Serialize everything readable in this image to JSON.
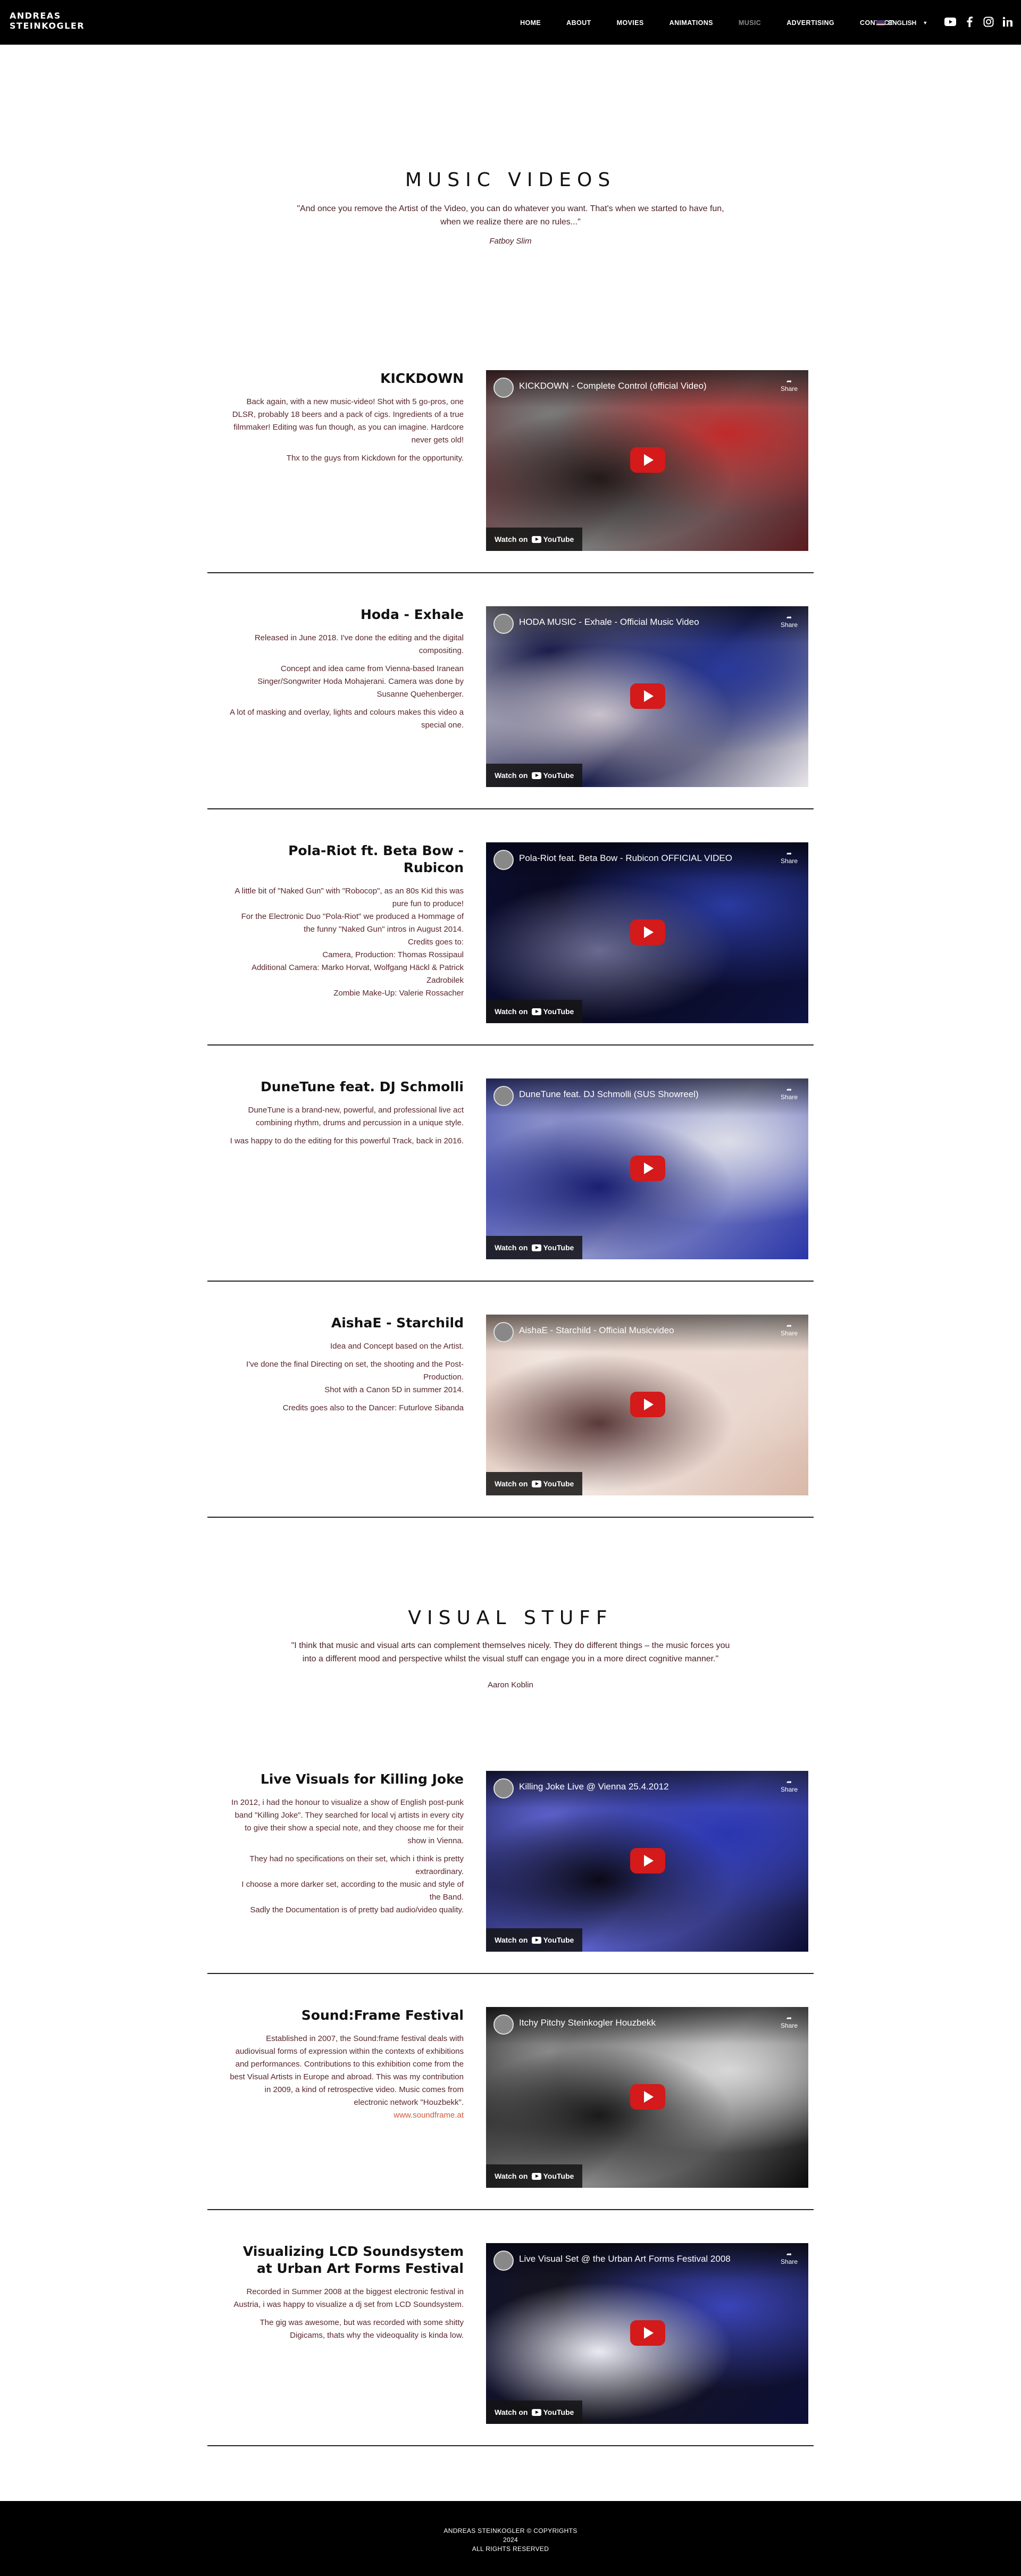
{
  "header": {
    "logo_line1": "ANDREAS",
    "logo_line2": "STEINKOGLER",
    "nav": [
      "HOME",
      "ABOUT",
      "MOVIES",
      "ANIMATIONS",
      "MUSIC",
      "ADVERTISING",
      "CONTACT"
    ],
    "active_nav": "MUSIC",
    "language": "ENGLISH",
    "social_icons": [
      "youtube-icon",
      "facebook-icon",
      "instagram-icon",
      "linkedin-icon"
    ]
  },
  "music": {
    "title": "MUSIC VIDEOS",
    "quote": "\"And once you remove the Artist of the Video, you can do whatever you want. That's when we started to have fun, when we realize there are no rules...\"",
    "author": "Fatboy Slim"
  },
  "visual": {
    "title": "VISUAL STUFF",
    "quote": "\"I think that music and visual arts can complement themselves nicely. They do different things – the music forces you into a different mood and perspective whilst the visual stuff can engage you in a more direct cognitive manner.\"",
    "author": "Aaron Koblin"
  },
  "projects": [
    {
      "title": "KICKDOWN",
      "paragraphs": [
        "Back again, with a new music-video! Shot with 5 go-pros, one DLSR, probably 18 beers and a pack of cigs. Ingredients of a true filmmaker! Editing was fun though, as you can imagine. Hardcore never gets old!",
        "Thx to the guys from Kickdown for the opportunity."
      ],
      "video_title": "KICKDOWN - Complete Control (official Video)",
      "colors": [
        "#5a1a1e",
        "#c22a2a",
        "#241a1a",
        "#7a7a7a"
      ]
    },
    {
      "title": "Hoda - Exhale",
      "paragraphs": [
        "Released in June 2018. I've done the editing and the digital compositing.",
        "Concept and idea came from Vienna-based Iranean Singer/Songwriter Hoda Mohajerani. Camera was done by Susanne Quehenberger.",
        "A lot of masking and overlay, lights and colours makes this video a special one."
      ],
      "video_title": "HODA MUSIC - Exhale - Official Music Video",
      "colors": [
        "#e9e6ea",
        "#2a3a9a",
        "#c9c2cc",
        "#1a1d4a"
      ]
    },
    {
      "title": "Pola-Riot ft. Beta Bow - Rubicon",
      "paragraphs": [
        "A little bit of \"Naked Gun\" with \"Robocop\", as an 80s Kid this was pure fun to produce!\nFor the Electronic Duo \"Pola-Riot\" we produced a Hommage of the funny \"Naked Gun\" intros in August 2014.\nCredits goes to:\nCamera, Production: Thomas Rossipaul\nAdditional Camera: Marko Horvat, Wolfgang Häckl & Patrick Zadrobilek\nZombie Make-Up: Valerie Rossacher"
      ],
      "video_title": "Pola-Riot feat. Beta Bow - Rubicon OFFICIAL VIDEO",
      "colors": [
        "#0d1240",
        "#2a3aa0",
        "#6a6a90",
        "#0a0a22"
      ]
    },
    {
      "title": "DuneTune feat. DJ Schmolli",
      "paragraphs": [
        "DuneTune is a brand-new, powerful, and professional live act combining rhythm, drums and percussion in a unique style.",
        "I was happy to do the editing for this powerful Track, back in 2016."
      ],
      "video_title": "DuneTune feat. DJ Schmolli (SUS Showreel)",
      "colors": [
        "#2a36a8",
        "#dcdde8",
        "#1a2070",
        "#8a90c8"
      ]
    },
    {
      "title": "AishaE - Starchild",
      "paragraphs": [
        "Idea and Concept based on the Artist.",
        "I've done the final Directing on set, the shooting and the Post-Production.\nShot with a Canon 5D in summer 2014.",
        "Credits goes also to the Dancer: Futurlove Sibanda"
      ],
      "video_title": "AishaE - Starchild - Official Musicvideo",
      "colors": [
        "#d9b8a8",
        "#ead8cf",
        "#5a3a3a",
        "#f1e6e0"
      ]
    },
    {
      "title": "Live Visuals for Killing Joke",
      "paragraphs": [
        "In 2012, i had the honour to visualize a show of English post-punk band \"Killing Joke\". They searched for local vj artists in every city to give their show a special note, and they choose me for their show in Vienna.",
        "They had no specifications on their set, which i think is pretty extraordinary.\nI choose a more darker set, according to the music and style of the Band.\nSadly the Documentation is of pretty bad audio/video quality."
      ],
      "video_title": "Killing Joke Live @ Vienna 25.4.2012",
      "colors": [
        "#0a0c30",
        "#2a36b0",
        "#0a0a18",
        "#5a60c8"
      ]
    },
    {
      "title": "Sound:Frame Festival",
      "paragraphs": [
        "Established in 2007, the Sound:frame festival deals with audiovisual forms of expression within the contexts of exhibitions and performances. Contributions to this exhibition come from the best Visual Artists in Europe and abroad. This was my contribution in 2009, a kind of retrospective video. Music comes from electronic network \"Houzbekk\"."
      ],
      "link_text": "www.soundframe.at",
      "video_title": "Itchy Pitchy Steinkogler Houzbekk",
      "colors": [
        "#0a0a0a",
        "#d8d8d8",
        "#1a1a1a",
        "#8a8a8a"
      ]
    },
    {
      "title": "Visualizing LCD Soundsystem at Urban Art Forms Festival",
      "paragraphs": [
        "Recorded in Summer 2008 at the biggest electronic festival in Austria, i was happy to visualize a dj set from LCD Soundsystem.",
        "The gig was awesome, but was recorded with some shitty Digicams, thats why the videoquality is kinda low."
      ],
      "video_title": "Live Visual Set @ the Urban Art Forms Festival 2008",
      "colors": [
        "#0c0e38",
        "#3a44b8",
        "#eaeaf2",
        "#151520"
      ]
    }
  ],
  "video_ui": {
    "share": "Share",
    "watch_on": "Watch on",
    "youtube": "YouTube"
  },
  "footer": {
    "line1": "ANDREAS STEINKOGLER © COPYRIGHTS",
    "line2": "2024",
    "line3": "ALL RIGHTS RESERVED"
  }
}
